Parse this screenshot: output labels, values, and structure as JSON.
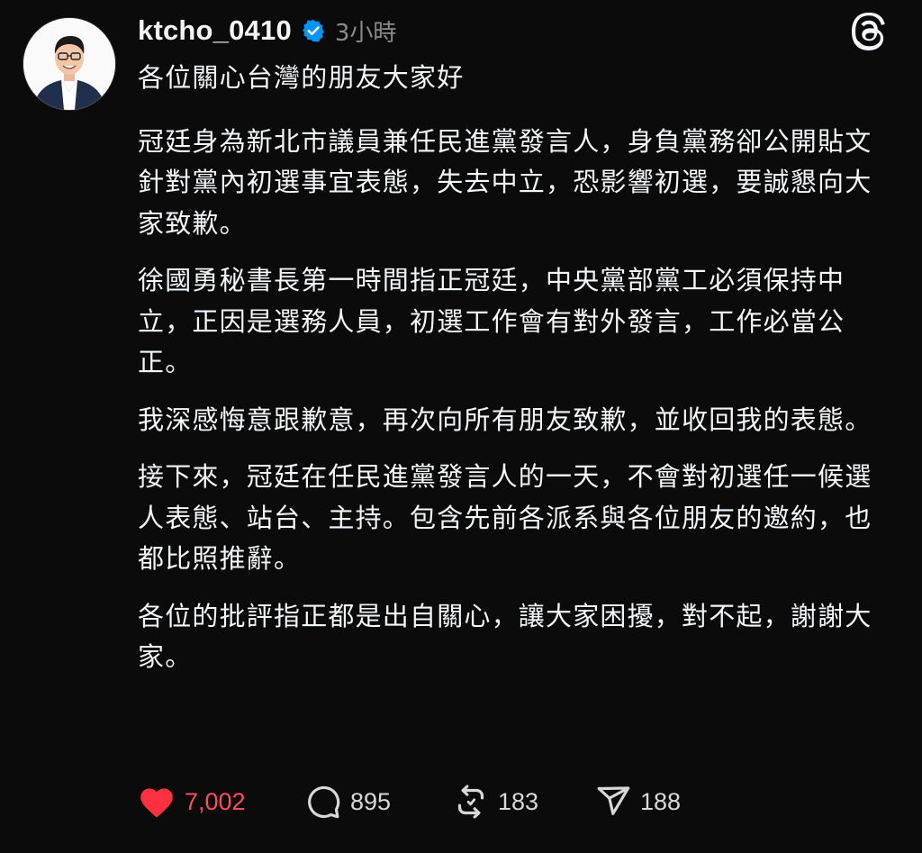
{
  "post": {
    "username": "ktcho_0410",
    "timestamp": "3小時",
    "verified_icon": "verified-badge-icon",
    "paragraphs": [
      "各位關心台灣的朋友大家好",
      "冠廷身為新北市議員兼任民進黨發言人，身負黨務卻公開貼文針對黨內初選事宜表態，失去中立，恐影響初選，要誠懇向大家致歉。",
      "徐國勇秘書長第一時間指正冠廷，中央黨部黨工必須保持中立，正因是選務人員，初選工作會有對外發言，工作必當公正。",
      "我深感悔意跟歉意，再次向所有朋友致歉，並收回我的表態。",
      "接下來，冠廷在任民進黨發言人的一天，不會對初選任一候選人表態、站台、主持。包含先前各派系與各位朋友的邀約，也都比照推辭。",
      "各位的批評指正都是出自關心，讓大家困擾，對不起，謝謝大家。"
    ]
  },
  "actions": {
    "likes": "7,002",
    "replies": "895",
    "reposts": "183",
    "shares": "188"
  },
  "icons": {
    "logo": "threads-logo-icon",
    "like": "heart-icon",
    "reply": "comment-icon",
    "repost": "repost-icon",
    "share": "send-icon"
  },
  "colors": {
    "background": "#0b0b0b",
    "text": "#f3f5f7",
    "muted": "#8a8a8a",
    "like": "#ff3040",
    "verified": "#0095f6"
  }
}
